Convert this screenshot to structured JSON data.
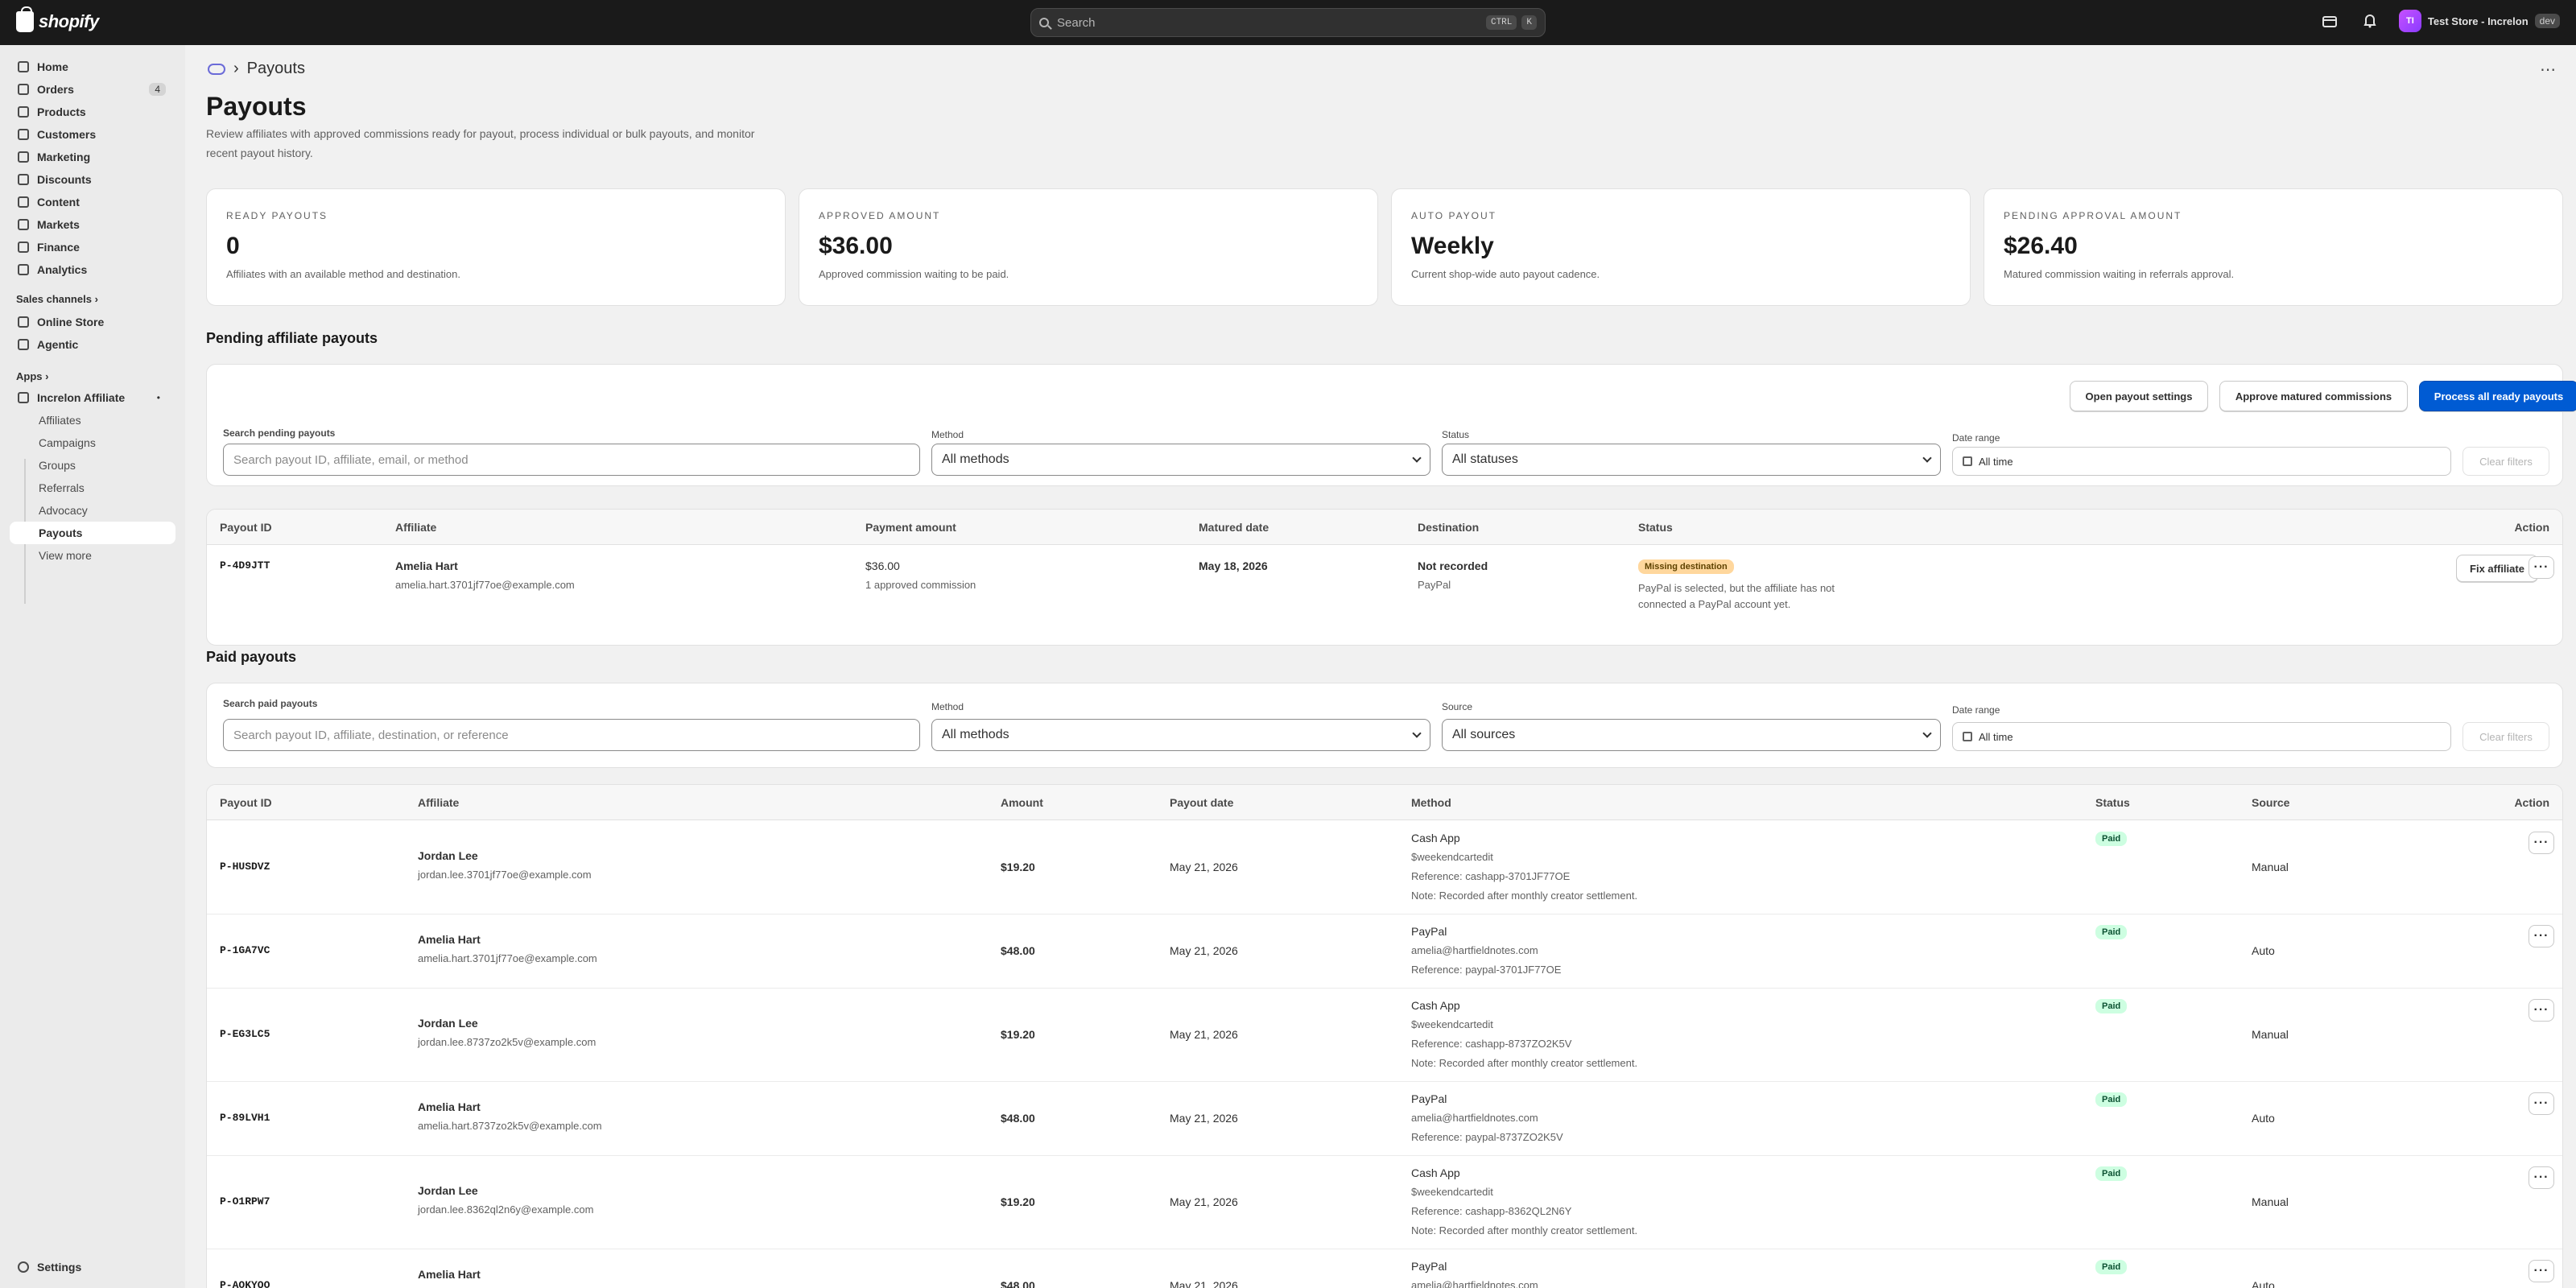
{
  "topbar": {
    "logo_text": "shopify",
    "search_placeholder": "Search",
    "kbd_ctrl": "CTRL",
    "kbd_k": "K",
    "store_initials": "TI",
    "store_name": "Test Store - Increlon",
    "dev_badge": "dev"
  },
  "sidebar": {
    "items": [
      {
        "label": "Home"
      },
      {
        "label": "Orders",
        "count": "4"
      },
      {
        "label": "Products"
      },
      {
        "label": "Customers"
      },
      {
        "label": "Marketing"
      },
      {
        "label": "Discounts"
      },
      {
        "label": "Content"
      },
      {
        "label": "Markets"
      },
      {
        "label": "Finance"
      },
      {
        "label": "Analytics"
      }
    ],
    "sales_channels_label": "Sales channels",
    "channels": [
      {
        "label": "Online Store"
      },
      {
        "label": "Agentic"
      }
    ],
    "apps_label": "Apps",
    "app_name": "Increlon Affiliate",
    "app_items": [
      {
        "label": "Affiliates"
      },
      {
        "label": "Campaigns"
      },
      {
        "label": "Groups"
      },
      {
        "label": "Referrals"
      },
      {
        "label": "Advocacy"
      },
      {
        "label": "Payouts"
      },
      {
        "label": "View more"
      }
    ],
    "settings_label": "Settings"
  },
  "page": {
    "breadcrumb": "Payouts",
    "title": "Payouts",
    "description": "Review affiliates with approved commissions ready for payout, process individual or bulk payouts, and monitor recent payout history."
  },
  "stats": [
    {
      "label": "READY PAYOUTS",
      "value": "0",
      "note": "Affiliates with an available method and destination."
    },
    {
      "label": "APPROVED AMOUNT",
      "value": "$36.00",
      "note": "Approved commission waiting to be paid."
    },
    {
      "label": "AUTO PAYOUT",
      "value": "Weekly",
      "note": "Current shop-wide auto payout cadence."
    },
    {
      "label": "PENDING APPROVAL AMOUNT",
      "value": "$26.40",
      "note": "Matured commission waiting in referrals approval."
    }
  ],
  "pending": {
    "title": "Pending affiliate payouts",
    "btn_settings": "Open payout settings",
    "btn_approve": "Approve matured commissions",
    "btn_process": "Process all ready payouts",
    "search_label": "Search pending payouts",
    "search_placeholder": "Search payout ID, affiliate, email, or method",
    "method_label": "Method",
    "method_value": "All methods",
    "status_label": "Status",
    "status_value": "All statuses",
    "date_label": "Date range",
    "date_value": "All time",
    "clear_label": "Clear filters",
    "headers": {
      "id": "Payout ID",
      "affiliate": "Affiliate",
      "amount": "Payment amount",
      "matured": "Matured date",
      "destination": "Destination",
      "status": "Status",
      "action": "Action"
    },
    "row": {
      "id": "P-4D9JTT",
      "name": "Amelia Hart",
      "email": "amelia.hart.3701jf77oe@example.com",
      "amount": "$36.00",
      "amount_note": "1 approved commission",
      "matured": "May 18, 2026",
      "destination": "Not recorded",
      "destination_method": "PayPal",
      "status_badge": "Missing destination",
      "status_note": "PayPal is selected, but the affiliate has not connected a PayPal account yet.",
      "action": "Fix affiliate"
    }
  },
  "paid": {
    "title": "Paid payouts",
    "search_label": "Search paid payouts",
    "search_placeholder": "Search payout ID, affiliate, destination, or reference",
    "method_label": "Method",
    "method_value": "All methods",
    "source_label": "Source",
    "source_value": "All sources",
    "date_label": "Date range",
    "date_value": "All time",
    "clear_label": "Clear filters",
    "headers": {
      "id": "Payout ID",
      "affiliate": "Affiliate",
      "amount": "Amount",
      "date": "Payout date",
      "method": "Method",
      "status": "Status",
      "source": "Source",
      "action": "Action"
    },
    "rows": [
      {
        "id": "P-HUSDVZ",
        "name": "Jordan Lee",
        "email": "jordan.lee.3701jf77oe@example.com",
        "amount": "$19.20",
        "date": "May 21, 2026",
        "method": "Cash App",
        "lines": [
          "$weekendcartedit",
          "Reference: cashapp-3701JF77OE",
          "Note: Recorded after monthly creator settlement."
        ],
        "status": "Paid",
        "source": "Manual"
      },
      {
        "id": "P-1GA7VC",
        "name": "Amelia Hart",
        "email": "amelia.hart.3701jf77oe@example.com",
        "amount": "$48.00",
        "date": "May 21, 2026",
        "method": "PayPal",
        "lines": [
          "amelia@hartfieldnotes.com",
          "Reference: paypal-3701JF77OE"
        ],
        "status": "Paid",
        "source": "Auto"
      },
      {
        "id": "P-EG3LC5",
        "name": "Jordan Lee",
        "email": "jordan.lee.8737zo2k5v@example.com",
        "amount": "$19.20",
        "date": "May 21, 2026",
        "method": "Cash App",
        "lines": [
          "$weekendcartedit",
          "Reference: cashapp-8737ZO2K5V",
          "Note: Recorded after monthly creator settlement."
        ],
        "status": "Paid",
        "source": "Manual"
      },
      {
        "id": "P-89LVH1",
        "name": "Amelia Hart",
        "email": "amelia.hart.8737zo2k5v@example.com",
        "amount": "$48.00",
        "date": "May 21, 2026",
        "method": "PayPal",
        "lines": [
          "amelia@hartfieldnotes.com",
          "Reference: paypal-8737ZO2K5V"
        ],
        "status": "Paid",
        "source": "Auto"
      },
      {
        "id": "P-O1RPW7",
        "name": "Jordan Lee",
        "email": "jordan.lee.8362ql2n6y@example.com",
        "amount": "$19.20",
        "date": "May 21, 2026",
        "method": "Cash App",
        "lines": [
          "$weekendcartedit",
          "Reference: cashapp-8362QL2N6Y",
          "Note: Recorded after monthly creator settlement."
        ],
        "status": "Paid",
        "source": "Manual"
      },
      {
        "id": "P-AOKYQO",
        "name": "Amelia Hart",
        "email": "",
        "amount": "$48.00",
        "date": "May 21, 2026",
        "method": "PayPal",
        "lines": [
          "amelia@hartfieldnotes.com"
        ],
        "status": "Paid",
        "source": "Auto"
      }
    ]
  },
  "icons": {
    "search": "search-icon",
    "bell": "bell-icon",
    "store": "store-icon",
    "more": "more-icon",
    "calendar": "calendar-icon"
  }
}
